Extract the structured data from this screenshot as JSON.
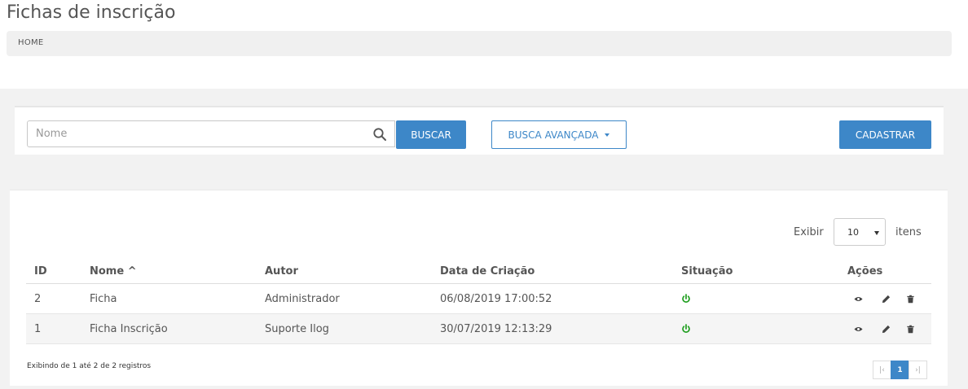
{
  "page": {
    "title": "Fichas de inscrição"
  },
  "breadcrumb": {
    "home": "HOME"
  },
  "search": {
    "placeholder": "Nome",
    "value": "",
    "buscar_label": "BUSCAR",
    "avancada_label": "BUSCA AVANÇADA",
    "cadastrar_label": "CADASTRAR"
  },
  "table": {
    "exibir_label": "Exibir",
    "page_size": "10",
    "itens_label": "itens",
    "headers": {
      "id": "ID",
      "nome": "Nome ^",
      "autor": "Autor",
      "data": "Data de Criação",
      "situacao": "Situação",
      "acoes": "Ações"
    },
    "rows": [
      {
        "id": "2",
        "nome": "Ficha",
        "autor": "Administrador",
        "data": "06/08/2019 17:00:52",
        "situacao": "active"
      },
      {
        "id": "1",
        "nome": "Ficha Inscrição",
        "autor": "Suporte Ilog",
        "data": "30/07/2019 12:13:29",
        "situacao": "active"
      }
    ],
    "status_color": "#1e9e1e",
    "footer_info": "Exibindo de 1 até 2 de 2 registros"
  },
  "pagination": {
    "first": "|‹",
    "current": "1",
    "last": "›|"
  },
  "colors": {
    "accent": "#3d87c8"
  }
}
